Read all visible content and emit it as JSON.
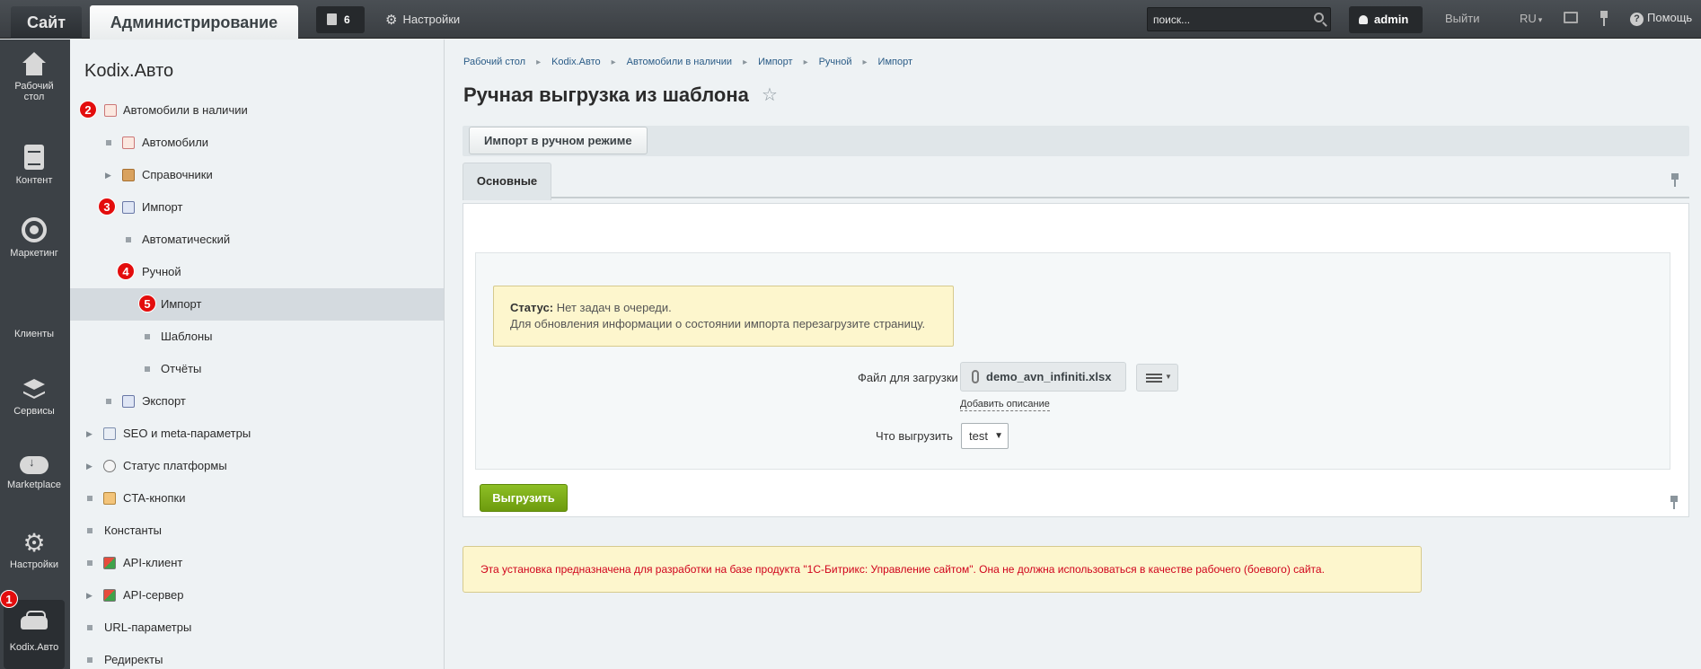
{
  "topbar": {
    "site_tab": "Сайт",
    "admin_tab": "Администрирование",
    "notifications_count": "6",
    "settings_label": "Настройки",
    "search_placeholder": "поиск...",
    "user_name": "admin",
    "logout_label": "Выйти",
    "language": "RU",
    "help_label": "Помощь"
  },
  "leftnav": {
    "items": [
      {
        "label": "Рабочий стол",
        "icon": "home-icon"
      },
      {
        "label": "Контент",
        "icon": "document-icon"
      },
      {
        "label": "Маркетинг",
        "icon": "target-icon"
      },
      {
        "label": "Клиенты",
        "icon": ""
      },
      {
        "label": "Сервисы",
        "icon": "layers-icon"
      },
      {
        "label": "Marketplace",
        "icon": "cloud-download-icon"
      },
      {
        "label": "Настройки",
        "icon": "gear-icon"
      },
      {
        "label": "Kodix.Авто",
        "icon": "car-icon"
      }
    ]
  },
  "badges": [
    "1",
    "2",
    "3",
    "4",
    "5"
  ],
  "menu": {
    "title": "Kodix.Авто",
    "items": [
      {
        "label": "Автомобили в наличии",
        "icon": "table-icon"
      },
      {
        "label": "Автомобили",
        "icon": "table-icon"
      },
      {
        "label": "Справочники",
        "icon": "book-icon"
      },
      {
        "label": "Импорт",
        "icon": "import-icon"
      },
      {
        "label": "Автоматический"
      },
      {
        "label": "Ручной"
      },
      {
        "label": "Импорт"
      },
      {
        "label": "Шаблоны"
      },
      {
        "label": "Отчёты"
      },
      {
        "label": "Экспорт",
        "icon": "import-icon"
      },
      {
        "label": "SEO и meta-параметры",
        "icon": "seo-icon"
      },
      {
        "label": "Статус платформы",
        "icon": "gauge-icon"
      },
      {
        "label": "CTA-кнопки",
        "icon": "cta-icon"
      },
      {
        "label": "Константы"
      },
      {
        "label": "API-клиент",
        "icon": "api-icon"
      },
      {
        "label": "API-сервер",
        "icon": "api-icon"
      },
      {
        "label": "URL-параметры"
      },
      {
        "label": "Редиректы"
      }
    ]
  },
  "breadcrumbs": [
    "Рабочий стол",
    "Kodix.Авто",
    "Автомобили в наличии",
    "Импорт",
    "Ручной",
    "Импорт"
  ],
  "page": {
    "title": "Ручная выгрузка из шаблона",
    "toolbar_button": "Импорт в ручном режиме",
    "tab_main": "Основные",
    "status_label": "Статус:",
    "status_value": "Нет задач в очереди.",
    "status_hint": "Для обновления информации о состоянии импорта перезагрузите страницу.",
    "file_label": "Файл для загрузки",
    "file_name": "demo_avn_infiniti.xlsx",
    "add_description": "Добавить описание",
    "what_label": "Что выгрузить",
    "what_value": "test",
    "submit_button": "Выгрузить",
    "warning": "Эта установка предназначена для разработки на базе продукта \"1С-Битрикс: Управление сайтом\". Она не должна использоваться в качестве рабочего (боевого) сайта."
  },
  "colors": {
    "topbar": "#3a3e42",
    "leftnav": "#3c4146",
    "badge": "#e30d0d",
    "submit": "#7aab15",
    "warning_text": "#d0021b",
    "notice_bg": "#fdf6cd"
  }
}
